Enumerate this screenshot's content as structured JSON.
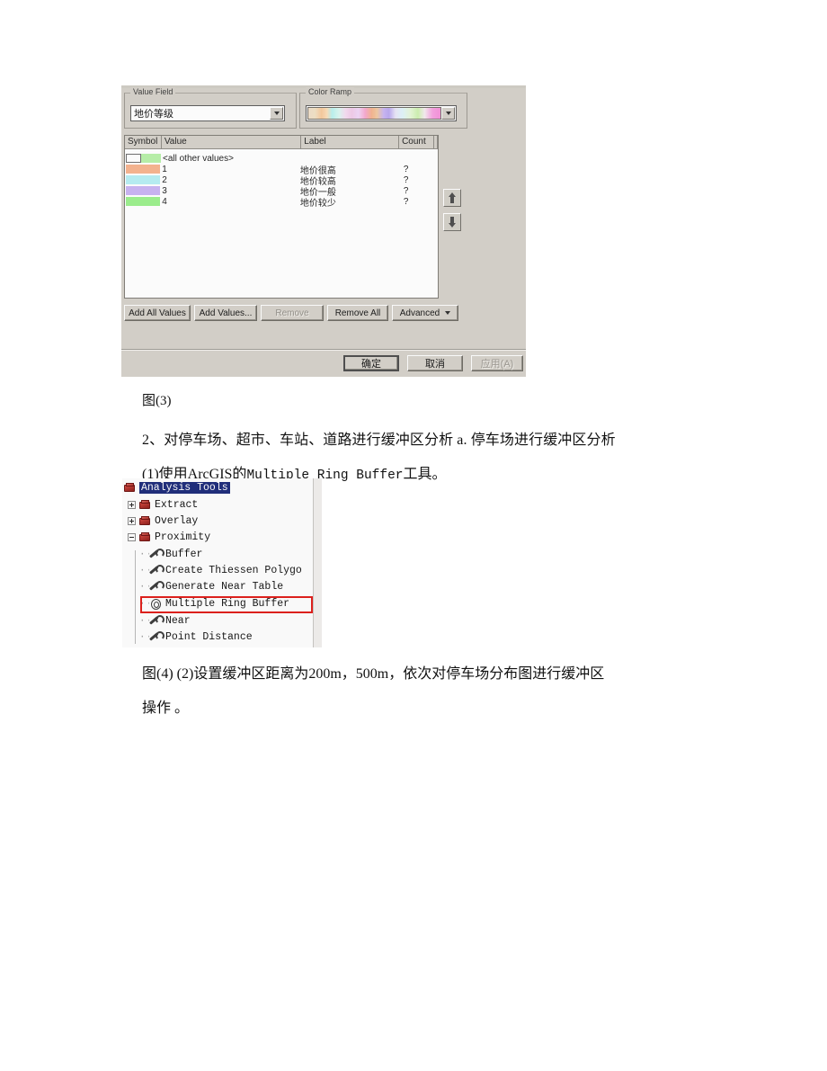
{
  "document": {
    "figure3_caption": "图(3)",
    "paragraph_step2": "2、对停车场、超市、车站、道路进行缓冲区分析 a. 停车场进行缓冲区分析",
    "paragraph_step2_1_prefix": "(1)使用ArcGIS的",
    "paragraph_step2_1_tool": "Multiple Ring Buffer",
    "paragraph_step2_1_suffix": "工具。",
    "figure4_line1": "图(4) (2)设置缓冲区距离为200m，500m，依次对停车场分布图进行缓冲区",
    "figure4_line2": "操作 。"
  },
  "symbology_dialog": {
    "value_field": {
      "caption": "Value Field",
      "selected": "地价等级",
      "dropdown_icon": "chevron-down-icon"
    },
    "color_ramp": {
      "caption": "Color Ramp",
      "dropdown_icon": "chevron-down-icon",
      "ramp_name": "pastel-multicolor-ramp"
    },
    "table": {
      "columns": [
        "Symbol",
        "Value",
        "Label",
        "Count"
      ],
      "rows": [
        {
          "swatch": "#b6f0a6",
          "symbol_kind": "null-and-swatch",
          "value": "<all other values>",
          "label": "",
          "count": ""
        },
        {
          "swatch": "#f7b28c",
          "symbol_kind": "swatch",
          "value": "1",
          "label": "地价很高",
          "count": "?"
        },
        {
          "swatch": "#b5eef3",
          "symbol_kind": "swatch",
          "value": "2",
          "label": "地价较高",
          "count": "?"
        },
        {
          "swatch": "#c8b2f2",
          "symbol_kind": "swatch",
          "value": "3",
          "label": "地价一般",
          "count": "?"
        },
        {
          "swatch": "#9aef8a",
          "symbol_kind": "swatch",
          "value": "4",
          "label": "地价较少",
          "count": "?"
        }
      ]
    },
    "move_up_icon": "arrow-up-icon",
    "move_down_icon": "arrow-down-icon",
    "buttons": {
      "add_all_values": "Add All Values",
      "add_values": "Add Values...",
      "remove": "Remove",
      "remove_all": "Remove All",
      "advanced": "Advanced"
    },
    "dialog_buttons": {
      "ok": "确定",
      "cancel": "取消",
      "apply": "应用(A)"
    },
    "colors": {
      "dialog_face": "#d4d0c8",
      "list_background": "#ffffff",
      "selection_blue": "#1b2a7a"
    }
  },
  "toolbox_tree": {
    "root": "Analysis Tools",
    "nodes": [
      {
        "label": "Analysis Tools",
        "icon": "toolbox-icon",
        "expander": "none",
        "selected": true
      },
      {
        "label": "Extract",
        "icon": "toolbox-icon",
        "expander": "plus",
        "selected": false
      },
      {
        "label": "Overlay",
        "icon": "toolbox-icon",
        "expander": "plus",
        "selected": false
      },
      {
        "label": "Proximity",
        "icon": "toolbox-icon",
        "expander": "minus",
        "selected": false
      },
      {
        "label": "Buffer",
        "icon": "wrench-icon",
        "expander": "none",
        "selected": false
      },
      {
        "label": "Create Thiessen Polygo",
        "icon": "wrench-icon",
        "expander": "none",
        "selected": false
      },
      {
        "label": "Generate Near Table",
        "icon": "wrench-icon",
        "expander": "none",
        "selected": false
      },
      {
        "label": "Multiple Ring Buffer",
        "icon": "ring-buffer-icon",
        "expander": "none",
        "selected": false
      },
      {
        "label": "Near",
        "icon": "wrench-icon",
        "expander": "none",
        "selected": false
      },
      {
        "label": "Point Distance",
        "icon": "wrench-icon",
        "expander": "none",
        "selected": false
      }
    ],
    "highlight_color": "#e11b17",
    "highlighted_node": "Multiple Ring Buffer"
  }
}
